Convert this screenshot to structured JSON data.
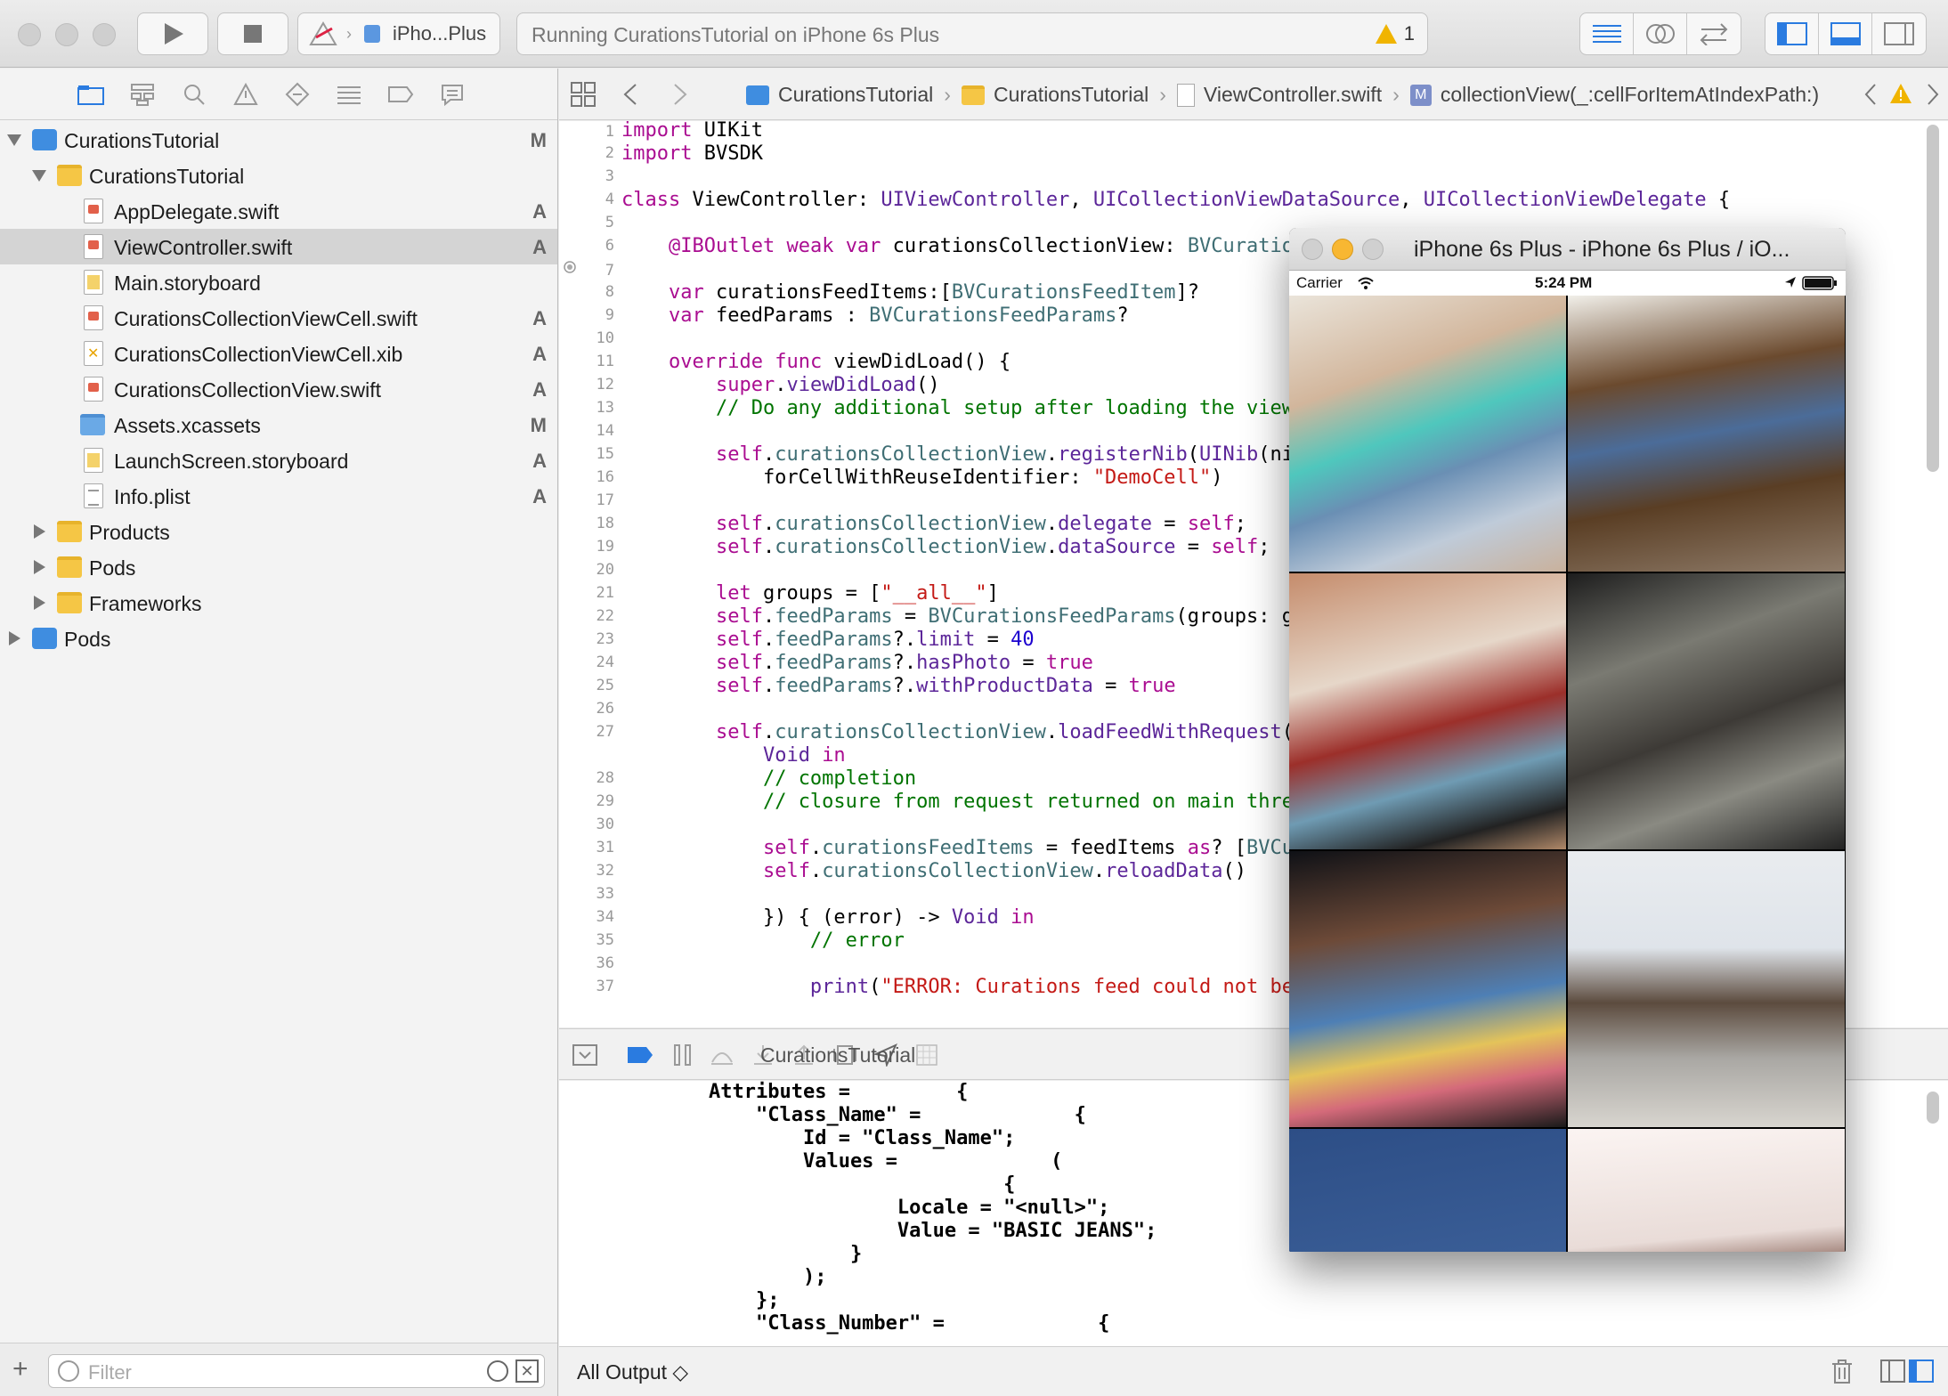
{
  "toolbar": {
    "scheme": "iPho...Plus",
    "activity_text": "Running CurationsTutorial on iPhone 6s Plus",
    "warning_count": "1"
  },
  "navigator": {
    "items": [
      {
        "label": "CurationsTutorial",
        "badge": "M"
      },
      {
        "label": "CurationsTutorial",
        "badge": ""
      },
      {
        "label": "AppDelegate.swift",
        "badge": "A"
      },
      {
        "label": "ViewController.swift",
        "badge": "A"
      },
      {
        "label": "Main.storyboard",
        "badge": ""
      },
      {
        "label": "CurationsCollectionViewCell.swift",
        "badge": "A"
      },
      {
        "label": "CurationsCollectionViewCell.xib",
        "badge": "A"
      },
      {
        "label": "CurationsCollectionView.swift",
        "badge": "A"
      },
      {
        "label": "Assets.xcassets",
        "badge": "M"
      },
      {
        "label": "LaunchScreen.storyboard",
        "badge": "A"
      },
      {
        "label": "Info.plist",
        "badge": "A"
      },
      {
        "label": "Products",
        "badge": ""
      },
      {
        "label": "Pods",
        "badge": ""
      },
      {
        "label": "Frameworks",
        "badge": ""
      },
      {
        "label": "Pods",
        "badge": ""
      }
    ],
    "filter_placeholder": "Filter"
  },
  "jumpbar": {
    "crumbs": [
      "CurationsTutorial",
      "CurationsTutorial",
      "ViewController.swift",
      "collectionView(_:cellForItemAtIndexPath:)"
    ]
  },
  "editor": {
    "line_numbers": [
      "1",
      "2",
      "3",
      "4",
      "5",
      "6",
      "7",
      "8",
      "9",
      "10",
      "11",
      "12",
      "13",
      "14",
      "15",
      "16",
      "17",
      "18",
      "19",
      "20",
      "21",
      "22",
      "23",
      "24",
      "25",
      "26",
      "27",
      "28",
      "29",
      "30",
      "31",
      "32",
      "33",
      "34",
      "35",
      "36",
      "37"
    ]
  },
  "debug": {
    "target_label": "CurationsTutorial",
    "output_selector": "All Output ◇"
  },
  "console": {
    "lines": [
      "Attributes =         {",
      "    \"Class_Name\" =             {",
      "        Id = \"Class_Name\";",
      "        Values =             (",
      "                         {",
      "                Locale = \"<null>\";",
      "                Value = \"BASIC JEANS\";",
      "            }",
      "        );",
      "    };",
      "    \"Class_Number\" =             {"
    ]
  },
  "simulator": {
    "title": "iPhone 6s Plus - iPhone 6s Plus / iO...",
    "carrier": "Carrier",
    "time": "5:24 PM"
  },
  "colors": {
    "selection": "#d4d4d4",
    "keyword": "#aa0d91",
    "type": "#5c2699",
    "string": "#c41a16",
    "comment": "#007400",
    "number": "#1c00cf"
  }
}
